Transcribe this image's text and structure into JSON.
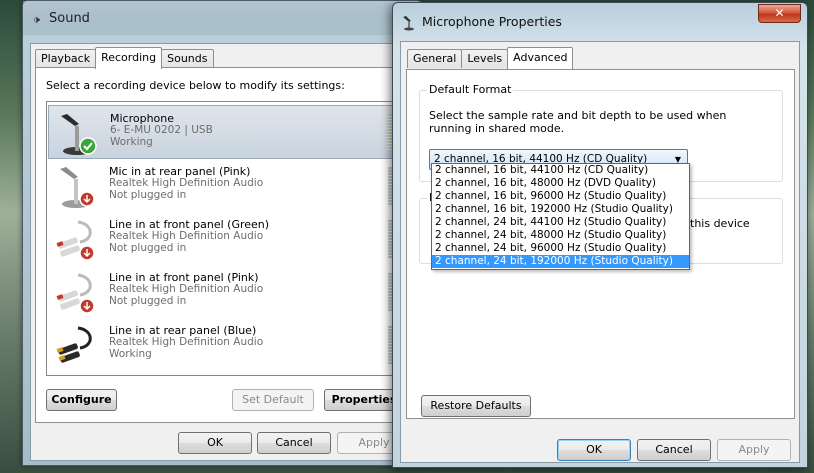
{
  "sound_window": {
    "title": "Sound",
    "title_icon": "speaker-icon",
    "tabs": [
      {
        "label": "Playback",
        "active": false
      },
      {
        "label": "Recording",
        "active": true
      },
      {
        "label": "Sounds",
        "active": false
      }
    ],
    "instruction": "Select a recording device below to modify its settings:",
    "devices": [
      {
        "name": "Microphone",
        "sub": "6- E-MU 0202 | USB",
        "status": "Working",
        "icon": "microphone-icon",
        "badge": "check-badge-icon",
        "selected": true
      },
      {
        "name": "Mic in at rear panel (Pink)",
        "sub": "Realtek High Definition Audio",
        "status": "Not plugged in",
        "icon": "microphone-icon",
        "badge": "unplugged-badge-icon",
        "selected": false
      },
      {
        "name": "Line in at front panel (Green)",
        "sub": "Realtek High Definition Audio",
        "status": "Not plugged in",
        "icon": "line-in-cable-icon",
        "badge": "unplugged-badge-icon",
        "selected": false
      },
      {
        "name": "Line in at front panel (Pink)",
        "sub": "Realtek High Definition Audio",
        "status": "Not plugged in",
        "icon": "line-in-cable-icon",
        "badge": "unplugged-badge-icon",
        "selected": false
      },
      {
        "name": "Line in at rear panel (Blue)",
        "sub": "Realtek High Definition Audio",
        "status": "Working",
        "icon": "line-in-cable-icon",
        "badge": "",
        "selected": false
      }
    ],
    "buttons": {
      "configure": "Configure",
      "set_default": "Set Default",
      "properties": "Properties",
      "ok": "OK",
      "cancel": "Cancel",
      "apply": "Apply"
    }
  },
  "mic_dialog": {
    "title": "Microphone Properties",
    "title_icon": "microphone-icon",
    "close_label": "✕",
    "tabs": [
      {
        "label": "General",
        "active": false
      },
      {
        "label": "Levels",
        "active": false
      },
      {
        "label": "Advanced",
        "active": true
      }
    ],
    "default_format": {
      "label": "Default Format",
      "description": "Select the sample rate and bit depth to be used when running in shared mode.",
      "selected": "2 channel, 16 bit, 44100 Hz (CD Quality)",
      "options": [
        "2 channel, 16 bit, 44100 Hz (CD Quality)",
        "2 channel, 16 bit, 48000 Hz (DVD Quality)",
        "2 channel, 16 bit, 96000 Hz (Studio Quality)",
        "2 channel, 16 bit, 192000 Hz (Studio Quality)",
        "2 channel, 24 bit, 44100 Hz (Studio Quality)",
        "2 channel, 24 bit, 48000 Hz (Studio Quality)",
        "2 channel, 24 bit, 96000 Hz (Studio Quality)",
        "2 channel, 24 bit, 192000 Hz (Studio Quality)"
      ],
      "highlighted_index": 7
    },
    "exclusive_group_label": "E",
    "exclusive_text": "this device",
    "buttons": {
      "restore_defaults": "Restore Defaults",
      "ok": "OK",
      "cancel": "Cancel",
      "apply": "Apply"
    }
  }
}
